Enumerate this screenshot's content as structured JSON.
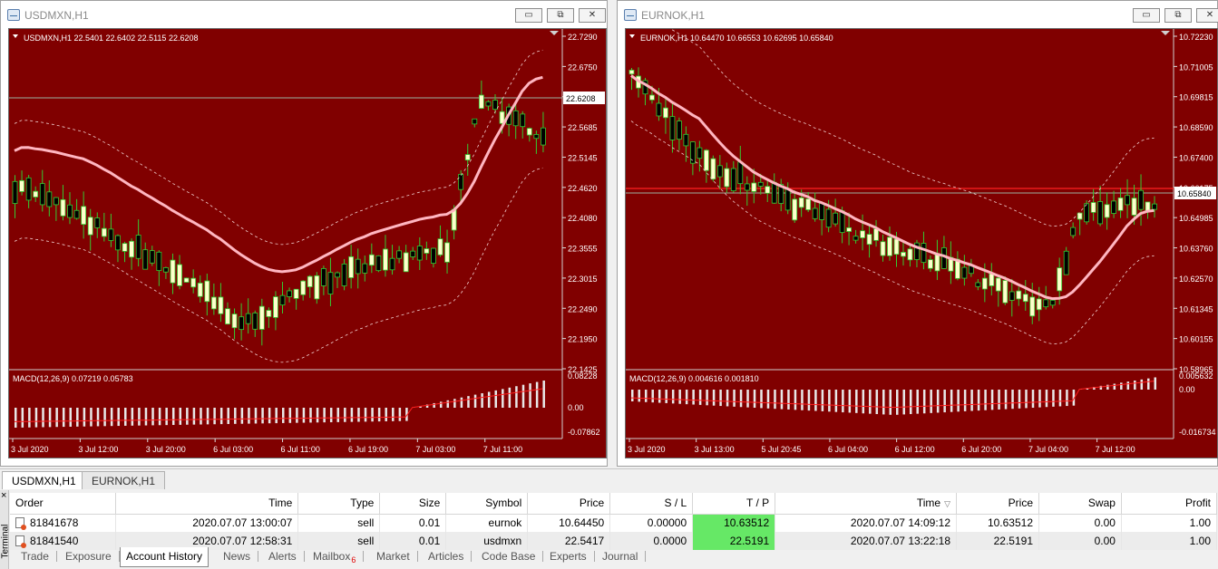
{
  "windows": [
    {
      "title": "USDMXN,H1",
      "header": "USDMXN,H1  22.5401 22.6402 22.5115 22.6208",
      "price_labels": [
        "22.7290",
        "22.6750",
        "22.6208",
        "22.5685",
        "22.5145",
        "22.4620",
        "22.4080",
        "22.3555",
        "22.3015",
        "22.2490",
        "22.1950",
        "22.1425"
      ],
      "current_price": "22.6208",
      "macd_label": "MACD(12,26,9) 0.07219 0.05783",
      "macd_scale": [
        "0.08228",
        "0.00",
        "-0.07862"
      ],
      "time_labels": [
        "3 Jul 2020",
        "3 Jul 12:00",
        "3 Jul 20:00",
        "6 Jul 03:00",
        "6 Jul 11:00",
        "6 Jul 19:00",
        "7 Jul 03:00",
        "7 Jul 11:00"
      ],
      "buttons": {
        "minimize": "▭",
        "restore": "⧉",
        "close": "✕"
      }
    },
    {
      "title": "EURNOK,H1",
      "header": "EURNOK,H1  10.64470 10.66553 10.62695 10.65840",
      "price_labels": [
        "10.72230",
        "10.71005",
        "10.69815",
        "10.68590",
        "10.67400",
        "10.66175",
        "10.64985",
        "10.63760",
        "10.62570",
        "10.61345",
        "10.60155",
        "10.58965"
      ],
      "current_price": "10.65840",
      "macd_label": "MACD(12,26,9) 0.004616 0.001810",
      "macd_scale": [
        "0.005632",
        "0.00",
        "-0.016734"
      ],
      "time_labels": [
        "3 Jul 2020",
        "3 Jul 13:00",
        "5 Jul 20:45",
        "6 Jul 04:00",
        "6 Jul 12:00",
        "6 Jul 20:00",
        "7 Jul 04:00",
        "7 Jul 12:00"
      ],
      "buttons": {
        "minimize": "▭",
        "restore": "⧉",
        "close": "✕"
      }
    }
  ],
  "chart_tabs": [
    "USDMXN,H1",
    "EURNOK,H1"
  ],
  "terminal": {
    "side_label": "Terminal",
    "close_icon": "×",
    "columns": [
      "Order",
      "Time",
      "Type",
      "Size",
      "Symbol",
      "Price",
      "S / L",
      "T / P",
      "Time",
      "Price",
      "Swap",
      "Profit"
    ],
    "rows": [
      [
        "81841678",
        "2020.07.07 13:00:07",
        "sell",
        "0.01",
        "eurnok",
        "10.64450",
        "0.00000",
        "10.63512",
        "2020.07.07 14:09:12",
        "10.63512",
        "0.00",
        "1.00"
      ],
      [
        "81841540",
        "2020.07.07 12:58:31",
        "sell",
        "0.01",
        "usdmxn",
        "22.5417",
        "0.0000",
        "22.5191",
        "2020.07.07 13:22:18",
        "22.5191",
        "0.00",
        "1.00"
      ]
    ],
    "tabs": [
      "Trade",
      "Exposure",
      "Account History",
      "News",
      "Alerts",
      "Mailbox",
      "Market",
      "Articles",
      "Code Base",
      "Experts",
      "Journal"
    ],
    "mailbox_count": "6",
    "active_tab": "Account History"
  },
  "colors": {
    "chart_bg": "#800000",
    "bull_candle": "#ffffcc",
    "wick": "#33cc33",
    "ma_line": "#ffb6c1",
    "tp_highlight": "#66e866"
  }
}
